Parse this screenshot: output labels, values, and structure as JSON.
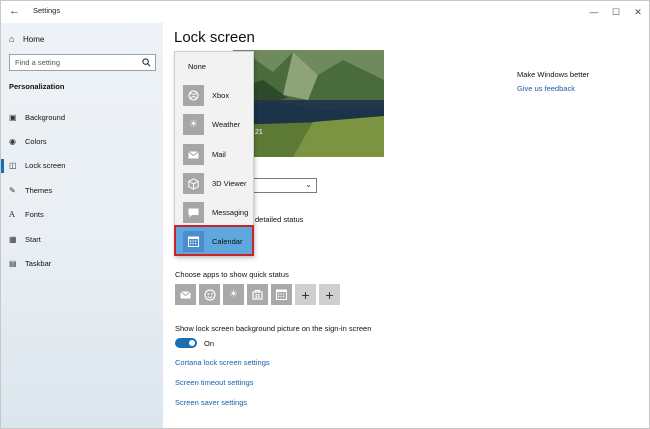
{
  "window": {
    "title": "Settings",
    "controls": [
      "—",
      "☐",
      "✕"
    ]
  },
  "sidebar": {
    "home_label": "Home",
    "search_placeholder": "Find a setting",
    "section_title": "Personalization",
    "items": [
      {
        "label": "Background",
        "icon": "picture-icon"
      },
      {
        "label": "Colors",
        "icon": "palette-icon"
      },
      {
        "label": "Lock screen",
        "icon": "lock-screen-icon",
        "active": true
      },
      {
        "label": "Themes",
        "icon": "brush-icon"
      },
      {
        "label": "Fonts",
        "icon": "font-icon"
      },
      {
        "label": "Start",
        "icon": "start-icon"
      },
      {
        "label": "Taskbar",
        "icon": "taskbar-icon"
      }
    ]
  },
  "main": {
    "title": "Lock screen",
    "preview_time": "21",
    "detail_status_text": "detailed status",
    "quick_status_label": "Choose apps to show quick status",
    "signin_label": "Show lock screen background picture on the sign-in screen",
    "toggle_state": "On",
    "links": [
      "Cortana lock screen settings",
      "Screen timeout settings",
      "Screen saver settings"
    ]
  },
  "related": {
    "title": "Make Windows better",
    "link": "Give us feedback"
  },
  "dropdown": {
    "items": [
      {
        "label": "None",
        "icon": ""
      },
      {
        "label": "Xbox",
        "icon": "xbox-icon"
      },
      {
        "label": "Weather",
        "icon": "weather-icon"
      },
      {
        "label": "Mail",
        "icon": "mail-icon"
      },
      {
        "label": "3D Viewer",
        "icon": "cube-icon"
      },
      {
        "label": "Messaging",
        "icon": "message-icon"
      },
      {
        "label": "Calendar",
        "icon": "calendar-icon",
        "selected": true
      }
    ]
  },
  "quick_status_apps": [
    "mail-icon",
    "people-icon",
    "weather-icon",
    "store-icon",
    "calendar-icon",
    "plus-icon",
    "plus-icon"
  ],
  "colors": {
    "accent": "#1a6fb3",
    "link": "#1a5fa8",
    "highlight": "#cc2229",
    "selected_item": "#5fa8de"
  }
}
